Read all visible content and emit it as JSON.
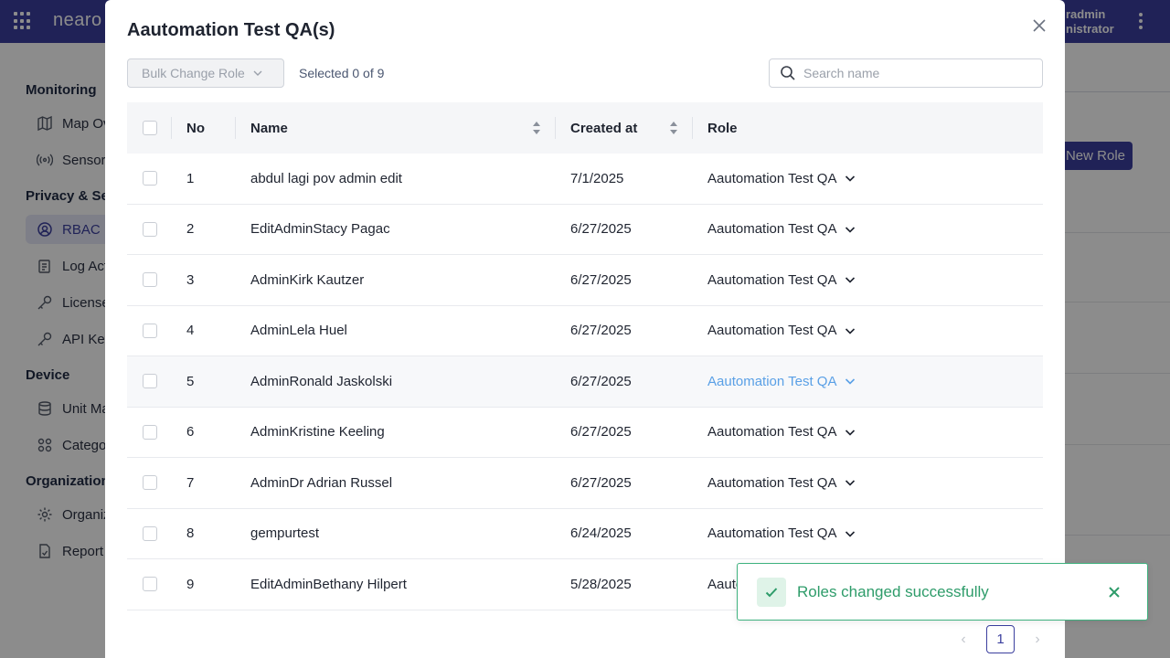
{
  "app": {
    "brand": "nearo",
    "user_name": "radmin",
    "user_role": "nistrator"
  },
  "sidebar": {
    "sections": [
      {
        "title": "Monitoring",
        "items": [
          {
            "label": "Map Ov",
            "icon": "map-icon"
          },
          {
            "label": "Sensor",
            "icon": "sensor-icon"
          }
        ]
      },
      {
        "title": "Privacy & Sec",
        "items": [
          {
            "label": "RBAC",
            "icon": "rbac-icon",
            "active": true
          },
          {
            "label": "Log Act",
            "icon": "log-icon"
          },
          {
            "label": "License",
            "icon": "key-icon"
          },
          {
            "label": "API Key",
            "icon": "key-icon"
          }
        ]
      },
      {
        "title": "Device",
        "items": [
          {
            "label": "Unit Ma",
            "icon": "database-icon"
          },
          {
            "label": "Catego",
            "icon": "category-icon"
          }
        ]
      },
      {
        "title": "Organization",
        "items": [
          {
            "label": "Organiz",
            "icon": "gear-icon"
          },
          {
            "label": "Report",
            "icon": "report-icon"
          }
        ]
      }
    ]
  },
  "background": {
    "new_role_label": "New Role"
  },
  "modal": {
    "title": "Aautomation Test QA(s)",
    "bulk_change_label": "Bulk Change Role",
    "selected_text": "Selected 0 of 9",
    "search_placeholder": "Search name",
    "columns": {
      "no": "No",
      "name": "Name",
      "created": "Created at",
      "role": "Role"
    },
    "rows": [
      {
        "no": "1",
        "name": "abdul lagi pov admin edit",
        "created": "7/1/2025",
        "role": "Aautomation Test QA"
      },
      {
        "no": "2",
        "name": "EditAdminStacy Pagac",
        "created": "6/27/2025",
        "role": "Aautomation Test QA"
      },
      {
        "no": "3",
        "name": "AdminKirk Kautzer",
        "created": "6/27/2025",
        "role": "Aautomation Test QA"
      },
      {
        "no": "4",
        "name": "AdminLela Huel",
        "created": "6/27/2025",
        "role": "Aautomation Test QA"
      },
      {
        "no": "5",
        "name": "AdminRonald Jaskolski",
        "created": "6/27/2025",
        "role": "Aautomation Test QA"
      },
      {
        "no": "6",
        "name": "AdminKristine Keeling",
        "created": "6/27/2025",
        "role": "Aautomation Test QA"
      },
      {
        "no": "7",
        "name": "AdminDr Adrian Russel",
        "created": "6/27/2025",
        "role": "Aautomation Test QA"
      },
      {
        "no": "8",
        "name": "gempurtest",
        "created": "6/24/2025",
        "role": "Aautomation Test QA"
      },
      {
        "no": "9",
        "name": "EditAdminBethany Hilpert",
        "created": "5/28/2025",
        "role": "Aautomation Test QA"
      }
    ],
    "pagination": {
      "current_page": "1"
    }
  },
  "toast": {
    "message": "Roles changed successfully"
  },
  "colors": {
    "primary": "#3b3f9e",
    "success": "#2e9c6a",
    "link_hover": "#5aa0e6"
  }
}
